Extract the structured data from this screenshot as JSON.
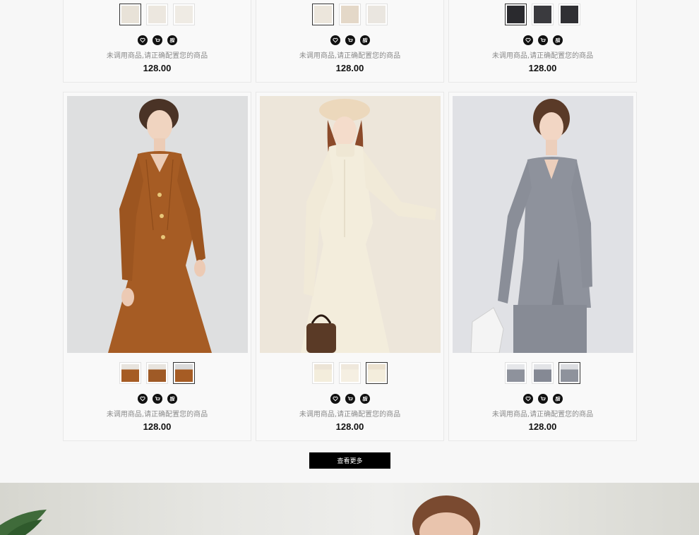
{
  "products_top": [
    {
      "name": "未调用商品,请正确配置您的商品",
      "price": "128.00",
      "swatches": [
        "beige",
        "beige",
        "beige"
      ],
      "active_swatch": 0
    },
    {
      "name": "未调用商品,请正确配置您的商品",
      "price": "128.00",
      "swatches": [
        "cream",
        "beige",
        "cream"
      ],
      "active_swatch": 0
    },
    {
      "name": "未调用商品,请正确配置您的商品",
      "price": "128.00",
      "swatches": [
        "black",
        "black",
        "black"
      ],
      "active_swatch": 0
    }
  ],
  "products": [
    {
      "name": "未调用商品,请正确配置您的商品",
      "price": "128.00",
      "dress_color": "#a65c24",
      "bg_color": "#dcdcdc",
      "swatches": [
        "rust",
        "rust",
        "rust"
      ],
      "active_swatch": 2
    },
    {
      "name": "未调用商品,请正确配置您的商品",
      "price": "128.00",
      "dress_color": "#f2ecdc",
      "bg_color": "#ece4d6",
      "swatches": [
        "cream",
        "cream",
        "cream"
      ],
      "active_swatch": 2
    },
    {
      "name": "未调用商品,请正确配置您的商品",
      "price": "128.00",
      "dress_color": "#8e929c",
      "bg_color": "#dedfe3",
      "swatches": [
        "grey",
        "grey",
        "grey"
      ],
      "active_swatch": 2
    }
  ],
  "icons": [
    "heart-icon",
    "cart-icon",
    "compare-icon"
  ],
  "load_more_label": "查看更多"
}
